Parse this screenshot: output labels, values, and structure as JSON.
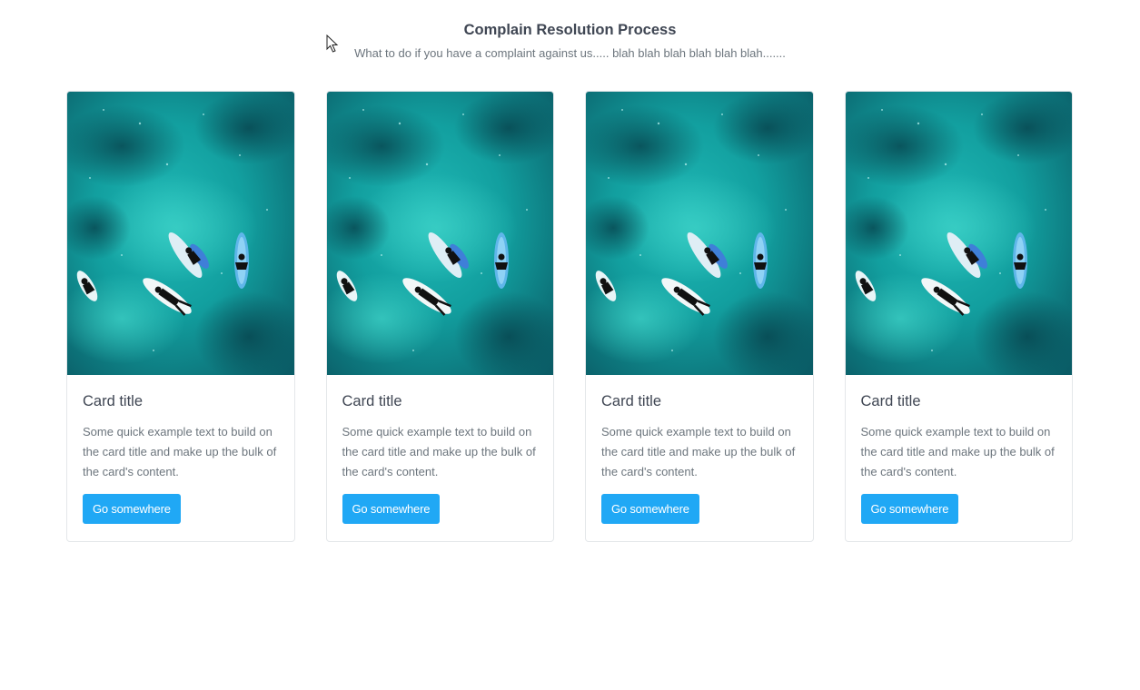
{
  "header": {
    "title": "Complain Resolution Process",
    "subtitle": "What to do if you have a complaint against us..... blah blah blah blah blah blah......."
  },
  "cards": [
    {
      "title": "Card title",
      "text": "Some quick example text to build on the card title and make up the bulk of the card's content.",
      "button_label": "Go somewhere",
      "image": "surfers-aerial-photo"
    },
    {
      "title": "Card title",
      "text": "Some quick example text to build on the card title and make up the bulk of the card's content.",
      "button_label": "Go somewhere",
      "image": "surfers-aerial-photo"
    },
    {
      "title": "Card title",
      "text": "Some quick example text to build on the card title and make up the bulk of the card's content.",
      "button_label": "Go somewhere",
      "image": "surfers-aerial-photo"
    },
    {
      "title": "Card title",
      "text": "Some quick example text to build on the card title and make up the bulk of the card's content.",
      "button_label": "Go somewhere",
      "image": "surfers-aerial-photo"
    }
  ],
  "colors": {
    "button": "#20a8f5",
    "water_dark": "#0b5560",
    "water_light": "#1fb5b3"
  },
  "cursor_icon": "mouse-pointer-icon"
}
